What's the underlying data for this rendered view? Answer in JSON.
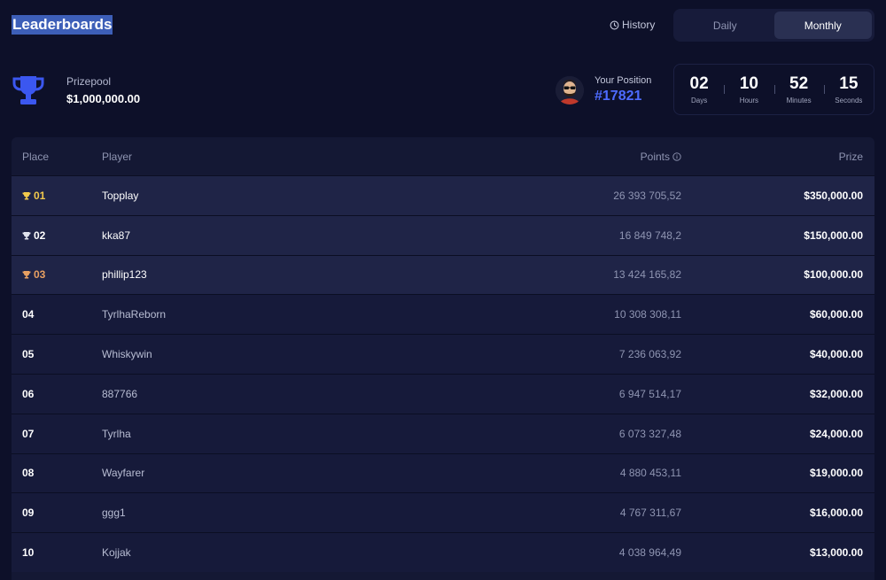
{
  "header": {
    "title": "Leaderboards",
    "history_label": "History",
    "tabs": [
      {
        "label": "Daily",
        "active": false
      },
      {
        "label": "Monthly",
        "active": true
      }
    ]
  },
  "prizepool": {
    "label": "Prizepool",
    "value": "$1,000,000.00",
    "icon": "trophy-icon",
    "icon_color": "#3b57f0"
  },
  "position": {
    "label": "Your Position",
    "value": "#17821",
    "color": "#4d6bff"
  },
  "countdown": [
    {
      "value": "02",
      "unit": "Days"
    },
    {
      "value": "10",
      "unit": "Hours"
    },
    {
      "value": "52",
      "unit": "Minutes"
    },
    {
      "value": "15",
      "unit": "Seconds"
    }
  ],
  "table": {
    "columns": {
      "place": "Place",
      "player": "Player",
      "points": "Points",
      "prize": "Prize"
    },
    "rows": [
      {
        "place": "01",
        "player": "Topplay",
        "points": "26 393 705,52",
        "prize": "$350,000.00",
        "trophy_color": "#f2c94c",
        "place_color": "#f2c94c",
        "highlight": true
      },
      {
        "place": "02",
        "player": "kka87",
        "points": "16 849 748,2",
        "prize": "$150,000.00",
        "trophy_color": "#e0e3ee",
        "place_color": "#ffffff",
        "highlight": true
      },
      {
        "place": "03",
        "player": "phillip123",
        "points": "13 424 165,82",
        "prize": "$100,000.00",
        "trophy_color": "#e8a062",
        "place_color": "#e8a062",
        "highlight": true
      },
      {
        "place": "04",
        "player": "TyrlhaReborn",
        "points": "10 308 308,11",
        "prize": "$60,000.00"
      },
      {
        "place": "05",
        "player": "Whiskywin",
        "points": "7 236 063,92",
        "prize": "$40,000.00"
      },
      {
        "place": "06",
        "player": "887766",
        "points": "6 947 514,17",
        "prize": "$32,000.00"
      },
      {
        "place": "07",
        "player": "Tyrlha",
        "points": "6 073 327,48",
        "prize": "$24,000.00"
      },
      {
        "place": "08",
        "player": "Wayfarer",
        "points": "4 880 453,11",
        "prize": "$19,000.00"
      },
      {
        "place": "09",
        "player": "ggg1",
        "points": "4 767 311,67",
        "prize": "$16,000.00"
      },
      {
        "place": "10",
        "player": "Kojjak",
        "points": "4 038 964,49",
        "prize": "$13,000.00"
      }
    ]
  }
}
